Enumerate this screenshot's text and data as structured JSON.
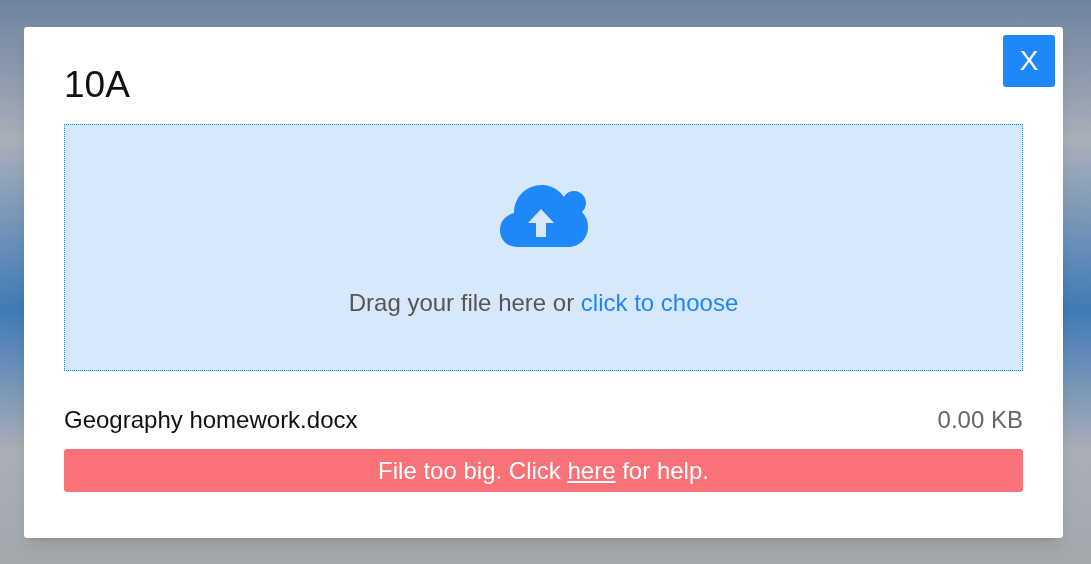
{
  "dialog": {
    "title": "10A",
    "close_button": "X"
  },
  "dropzone": {
    "prompt": "Drag your file here or",
    "link": "click to choose"
  },
  "file": {
    "name": "Geography homework.docx",
    "size": "0.00 KB"
  },
  "error": {
    "before": "File too big. Click",
    "link": "here",
    "after": "for help."
  }
}
